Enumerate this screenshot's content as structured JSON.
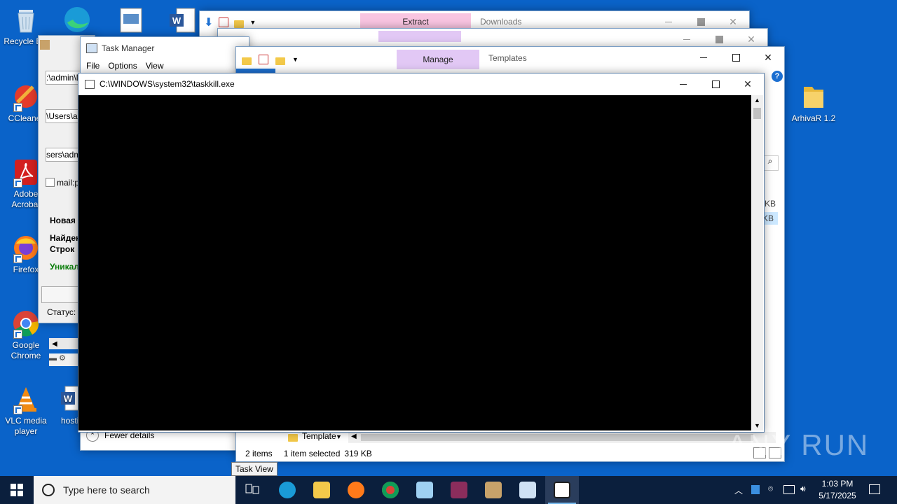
{
  "desktop": {
    "icons": [
      {
        "label": "Recycle Bin",
        "name": "recycle-bin"
      },
      {
        "label": "CCleaner",
        "name": "ccleaner"
      },
      {
        "label": "Adobe Acrobat",
        "name": "adobe-acrobat"
      },
      {
        "label": "Firefox",
        "name": "firefox"
      },
      {
        "label": "Google Chrome",
        "name": "google-chrome"
      },
      {
        "label": "VLC media player",
        "name": "vlc"
      },
      {
        "label": "hostin",
        "name": "word-doc"
      },
      {
        "label": "ArhivaR 1.2",
        "name": "arhivar-folder"
      }
    ]
  },
  "explorer_back": {
    "ribbon_tab": "Extract",
    "title": "Downloads"
  },
  "explorer_front": {
    "ribbon_tab": "Manage",
    "title": "Templates",
    "size_col_1": "KB",
    "size_col_2": "KB",
    "nav_item": "Template",
    "status": {
      "items": "2 items",
      "selected": "1 item selected",
      "size": "319 KB"
    }
  },
  "task_manager": {
    "title": "Task Manager",
    "menu": [
      "File",
      "Options",
      "View"
    ],
    "fewer_details": "Fewer details"
  },
  "left_app": {
    "path1": ":\\admin\\D",
    "path2": "\\Users\\a",
    "path3": "sers\\admi",
    "checkbox_label": "mail:p",
    "label_new": "Новая",
    "label_found": "Найден",
    "label_rows": "Строк",
    "label_unique": "Уникал",
    "status_label": "Статус:"
  },
  "console": {
    "title": "C:\\WINDOWS\\system32\\taskkill.exe"
  },
  "tooltip": "Task View",
  "watermark": "ANY RUN",
  "taskbar": {
    "search_placeholder": "Type here to search",
    "time": "1:03 PM",
    "date": "5/17/2025"
  },
  "colors": {
    "desktop": "#0a63c9",
    "taskbar": "#0b1f3d",
    "extract_tab": "#f9c5e1",
    "manage_tab": "#e2c8f5",
    "console_bg": "#000000"
  }
}
